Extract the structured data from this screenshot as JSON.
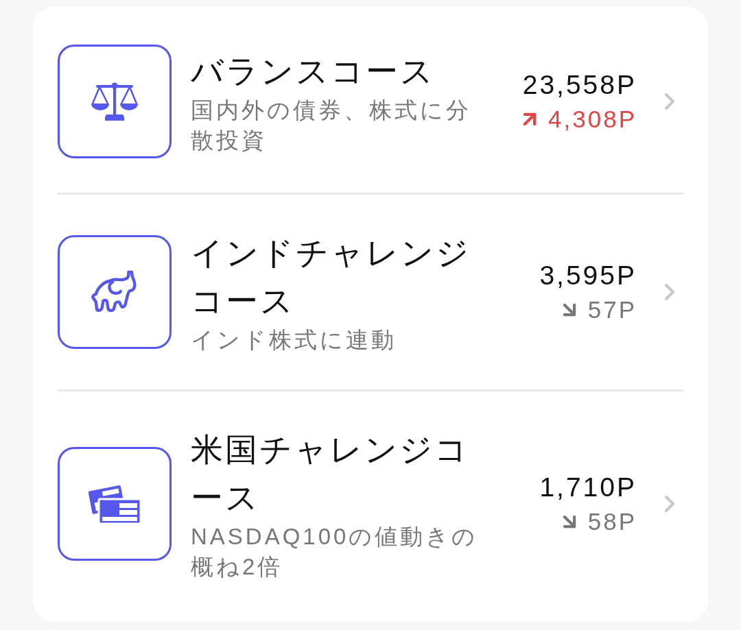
{
  "courses": [
    {
      "kind": "scales",
      "title": "バランスコース",
      "description": "国内外の債券、株式に分散投資",
      "points": "23,558P",
      "change": "4,308P",
      "rising": true
    },
    {
      "kind": "elephant",
      "title": "インドチャレンジコース",
      "description": "インド株式に連動",
      "points": "3,595P",
      "change": "57P",
      "rising": false
    },
    {
      "kind": "cards",
      "title": "米国チャレンジコース",
      "description": "NASDAQ100の値動きの概ね2倍",
      "points": "1,710P",
      "change": "58P",
      "rising": false
    }
  ]
}
